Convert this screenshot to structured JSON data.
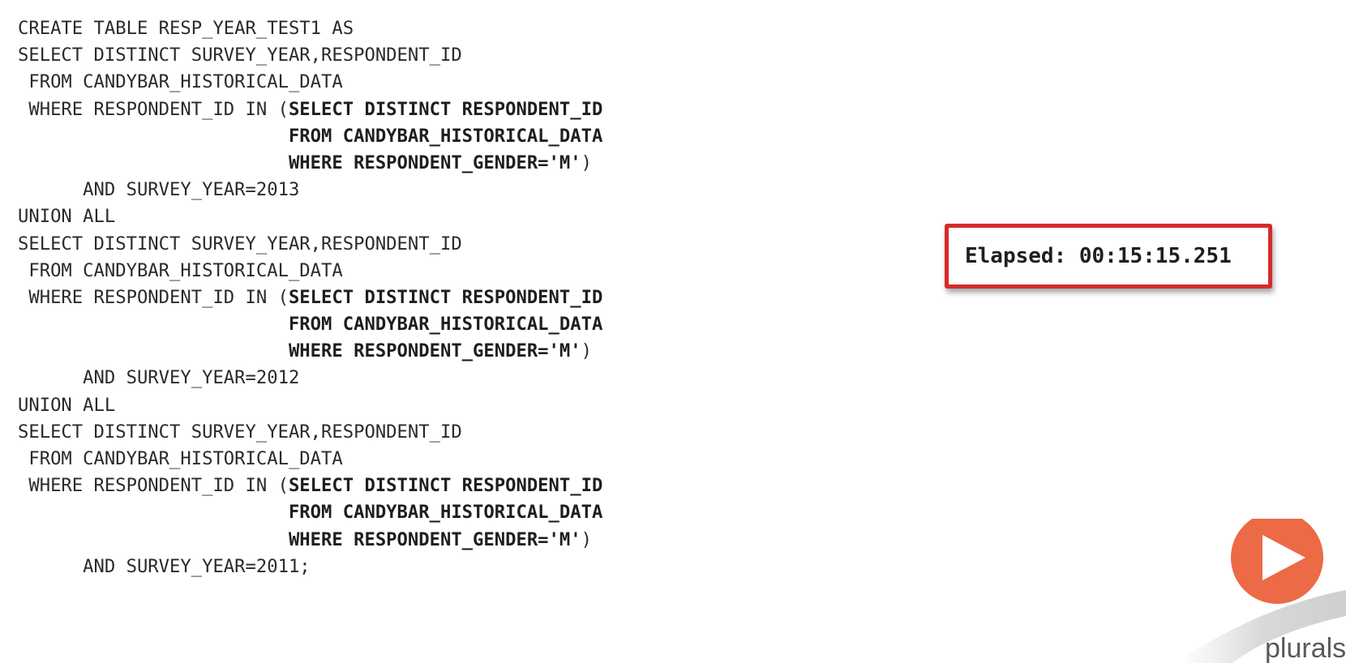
{
  "code": {
    "lines": [
      {
        "plain": "CREATE TABLE RESP_YEAR_TEST1 AS",
        "bold": "",
        "tail": ""
      },
      {
        "plain": "SELECT DISTINCT SURVEY_YEAR,RESPONDENT_ID",
        "bold": "",
        "tail": ""
      },
      {
        "plain": " FROM CANDYBAR_HISTORICAL_DATA",
        "bold": "",
        "tail": ""
      },
      {
        "plain": " WHERE RESPONDENT_ID IN (",
        "bold": "SELECT DISTINCT RESPONDENT_ID",
        "tail": ""
      },
      {
        "plain": "                         ",
        "bold": "FROM CANDYBAR_HISTORICAL_DATA",
        "tail": ""
      },
      {
        "plain": "                         ",
        "bold": "WHERE RESPONDENT_GENDER='M'",
        "tail": ")"
      },
      {
        "plain": "      AND SURVEY_YEAR=2013",
        "bold": "",
        "tail": ""
      },
      {
        "plain": "UNION ALL",
        "bold": "",
        "tail": ""
      },
      {
        "plain": "SELECT DISTINCT SURVEY_YEAR,RESPONDENT_ID",
        "bold": "",
        "tail": ""
      },
      {
        "plain": " FROM CANDYBAR_HISTORICAL_DATA",
        "bold": "",
        "tail": ""
      },
      {
        "plain": " WHERE RESPONDENT_ID IN (",
        "bold": "SELECT DISTINCT RESPONDENT_ID",
        "tail": ""
      },
      {
        "plain": "                         ",
        "bold": "FROM CANDYBAR_HISTORICAL_DATA",
        "tail": ""
      },
      {
        "plain": "                         ",
        "bold": "WHERE RESPONDENT_GENDER='M'",
        "tail": ")"
      },
      {
        "plain": "      AND SURVEY_YEAR=2012",
        "bold": "",
        "tail": ""
      },
      {
        "plain": "UNION ALL",
        "bold": "",
        "tail": ""
      },
      {
        "plain": "SELECT DISTINCT SURVEY_YEAR,RESPONDENT_ID",
        "bold": "",
        "tail": ""
      },
      {
        "plain": " FROM CANDYBAR_HISTORICAL_DATA",
        "bold": "",
        "tail": ""
      },
      {
        "plain": " WHERE RESPONDENT_ID IN (",
        "bold": "SELECT DISTINCT RESPONDENT_ID",
        "tail": ""
      },
      {
        "plain": "                         ",
        "bold": "FROM CANDYBAR_HISTORICAL_DATA",
        "tail": ""
      },
      {
        "plain": "                         ",
        "bold": "WHERE RESPONDENT_GENDER='M'",
        "tail": ")"
      },
      {
        "plain": "      AND SURVEY_YEAR=2011;",
        "bold": "",
        "tail": ""
      }
    ]
  },
  "elapsed": {
    "text": "Elapsed: 00:15:15.251",
    "border_color": "#d62b2b"
  },
  "logo": {
    "icon": "play-icon",
    "wordmark": "plurals",
    "color": "#ec6a45"
  }
}
